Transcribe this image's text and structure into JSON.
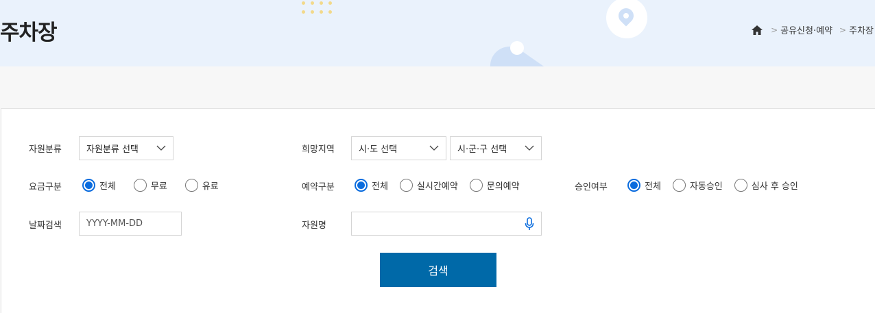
{
  "header": {
    "title": "주차장",
    "breadcrumb": [
      "공유신청·예약",
      "주차장"
    ],
    "colors": {
      "background": "#eaf2fc",
      "accent": "#0069a8",
      "radio_active": "#0a6cde"
    }
  },
  "filters": {
    "resource_type": {
      "label": "자원분류",
      "selected": "자원분류 선택"
    },
    "region": {
      "label": "희망지역",
      "province_selected": "시·도 선택",
      "city_selected": "시·군·구 선택"
    },
    "fee": {
      "label": "요금구분",
      "options": [
        "전체",
        "무료",
        "유료"
      ],
      "selected": "전체"
    },
    "reservation": {
      "label": "예약구분",
      "options": [
        "전체",
        "실시간예약",
        "문의예약"
      ],
      "selected": "전체"
    },
    "approval": {
      "label": "승인여부",
      "options": [
        "전체",
        "자동승인",
        "심사 후 승인"
      ],
      "selected": "전체"
    },
    "date": {
      "label": "날짜검색",
      "placeholder": "YYYY-MM-DD",
      "value": ""
    },
    "resource_name": {
      "label": "자원명",
      "placeholder": "",
      "value": ""
    },
    "search_label": "검색"
  },
  "icons": [
    "home-icon",
    "chevron-right-icon",
    "chevron-down-icon",
    "microphone-icon",
    "location-pin-icon"
  ]
}
